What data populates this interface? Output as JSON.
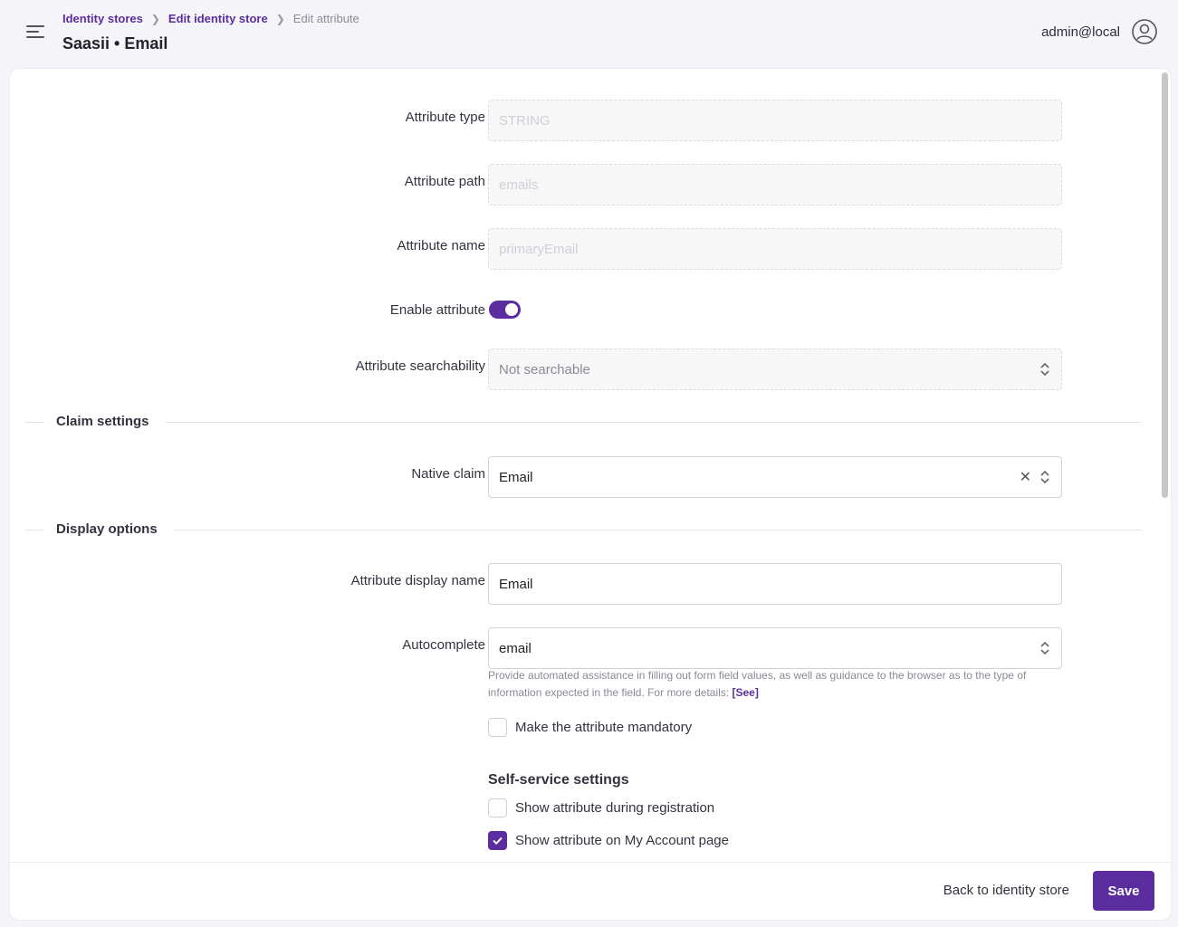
{
  "header": {
    "breadcrumbs": [
      "Identity stores",
      "Edit identity store",
      "Edit attribute"
    ],
    "title": "Saasii • Email",
    "user": "admin@local"
  },
  "form": {
    "attribute_type": {
      "label": "Attribute type",
      "value": "STRING"
    },
    "attribute_path": {
      "label": "Attribute path",
      "value": "emails"
    },
    "attribute_name": {
      "label": "Attribute name",
      "value": "primaryEmail"
    },
    "enable_attribute": {
      "label": "Enable attribute",
      "enabled": true
    },
    "searchability": {
      "label": "Attribute searchability",
      "value": "Not searchable"
    }
  },
  "claim_settings": {
    "section_title": "Claim settings",
    "native_claim": {
      "label": "Native claim",
      "value": "Email"
    }
  },
  "display_options": {
    "section_title": "Display options",
    "display_name": {
      "label": "Attribute display name",
      "value": "Email"
    },
    "autocomplete": {
      "label": "Autocomplete",
      "value": "email",
      "help": "Provide automated assistance in filling out form field values, as well as guidance to the browser as to the type of information expected in the field. For more details:",
      "help_link": "[See]"
    },
    "mandatory": {
      "label": "Make the attribute mandatory",
      "checked": false
    }
  },
  "self_service": {
    "title": "Self-service settings",
    "show_registration": {
      "label": "Show attribute during registration",
      "checked": false
    },
    "show_my_account": {
      "label": "Show attribute on My Account page",
      "checked": true
    }
  },
  "footer": {
    "back_label": "Back to identity store",
    "save_label": "Save"
  },
  "colors": {
    "accent": "#5b2d9f"
  },
  "icons": [
    "menu-icon",
    "chevron-right-icon",
    "user-circle-icon",
    "updown-chevron-icon",
    "clear-icon",
    "checkmark-icon"
  ]
}
